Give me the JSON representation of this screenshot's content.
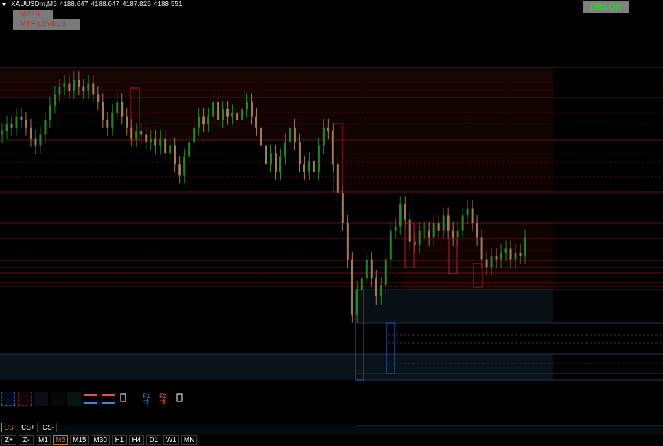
{
  "header": {
    "symbol": "XAUUSDm,M5",
    "open": "4188.647",
    "high": "4188.647",
    "low": "4187.826",
    "close": "4188.551"
  },
  "buttons": {
    "mzz9": "MZZ9",
    "mtf_levels": "MTF LEVELS",
    "dbs": "DBS ON"
  },
  "cs_row": [
    {
      "label": "CS",
      "active": true
    },
    {
      "label": "CS+",
      "active": false
    },
    {
      "label": "CS-",
      "active": false
    }
  ],
  "tf_row": [
    {
      "label": "Z+",
      "active": false
    },
    {
      "label": "Z-",
      "active": false
    },
    {
      "label": "M1",
      "active": false
    },
    {
      "label": "M5",
      "active": true
    },
    {
      "label": "M15",
      "active": false
    },
    {
      "label": "M30",
      "active": false
    },
    {
      "label": "H1",
      "active": false
    },
    {
      "label": "H4",
      "active": false
    },
    {
      "label": "D1",
      "active": false
    },
    {
      "label": "W1",
      "active": false
    },
    {
      "label": "MN",
      "active": false
    }
  ],
  "tools": {
    "f1_label": "F1",
    "f2_label": "F2",
    "icons": [
      "blue-dashed-zone-icon",
      "red-dashed-zone-icon",
      "dark-zone-icon",
      "black-zone-icon",
      "green-zone-icon",
      "red-blue-lines-icon",
      "red-blue-lines-icon",
      "white-box-icon",
      "f1-arrows-icon",
      "f2-arrows-icon",
      "white-box-icon"
    ]
  },
  "colors": {
    "bull": "#1f8a22",
    "bear": "#a27a55",
    "supply_zone": "#8b1a1a",
    "demand_zone": "#2a5d9a",
    "active_tab": "#e0731b",
    "dbs_text": "#20e020",
    "label_red": "#e02020"
  },
  "price_series": [
    4195,
    4197,
    4196,
    4199,
    4198,
    4196,
    4193,
    4191,
    4194,
    4198,
    4202,
    4205,
    4207,
    4208,
    4206,
    4209,
    4207,
    4206,
    4208,
    4205,
    4203,
    4198,
    4196,
    4200,
    4203,
    4199,
    4196,
    4193,
    4195,
    4194,
    4192,
    4193,
    4191,
    4193,
    4189,
    4191,
    4186,
    4183,
    4188,
    4192,
    4196,
    4199,
    4197,
    4199,
    4203,
    4198,
    4201,
    4199,
    4200,
    4198,
    4201,
    4203,
    4199,
    4196,
    4191,
    4186,
    4189,
    4184,
    4188,
    4192,
    4196,
    4192,
    4186,
    4184,
    4187,
    4184,
    4191,
    4196,
    4195,
    4186,
    4178,
    4170,
    4160,
    4145,
    4152,
    4155,
    4160,
    4155,
    4150,
    4153,
    4160,
    4168,
    4169,
    4175,
    4171,
    4165,
    4164,
    4168,
    4168,
    4166,
    4170,
    4168,
    4172,
    4168,
    4166,
    4168,
    4172,
    4174,
    4170,
    4166,
    4160,
    4158,
    4161,
    4160,
    4162,
    4163,
    4160,
    4162,
    4161,
    4166
  ]
}
